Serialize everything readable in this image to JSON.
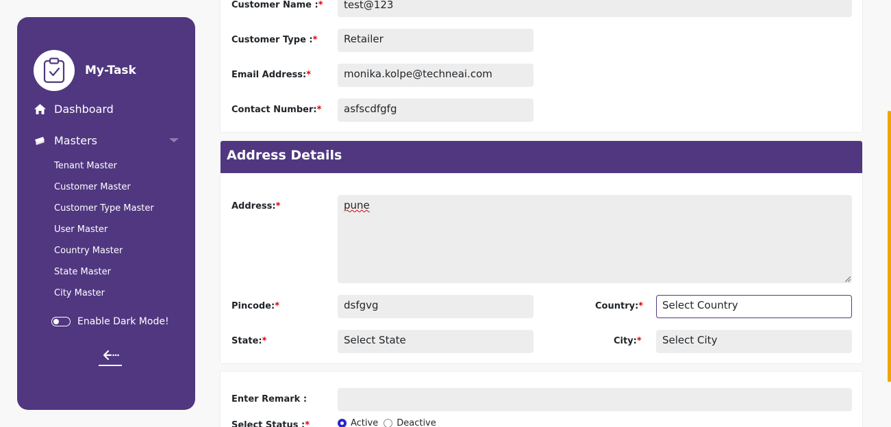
{
  "sidebar": {
    "app_title": "My-Task",
    "dashboard_label": "Dashboard",
    "masters_label": "Masters",
    "submenu": [
      "Tenant Master",
      "Customer Master",
      "Customer Type Master",
      "User Master",
      "Country Master",
      "State Master",
      "City Master"
    ],
    "dark_mode_label": "Enable Dark Mode!"
  },
  "customer": {
    "name_label": "Customer Name :",
    "name_value": "test@123",
    "type_label": "Customer Type :",
    "type_value": "Retailer",
    "email_label": "Email Address:",
    "email_value": "monika.kolpe@techneai.com",
    "contact_label": "Contact Number:",
    "contact_value": "asfscdfgfg"
  },
  "address": {
    "header": "Address Details",
    "address_label": "Address:",
    "address_value": "pune",
    "pincode_label": "Pincode:",
    "pincode_value": "dsfgvg",
    "country_label": "Country:",
    "country_value": "Select Country",
    "state_label": "State:",
    "state_value": "Select State",
    "city_label": "City:",
    "city_value": "Select City"
  },
  "remarks": {
    "remark_label": "Enter Remark :",
    "remark_value": "",
    "status_label": "Select Status :",
    "status_options": [
      "Active",
      "Deactive"
    ],
    "status_selected": "Active"
  },
  "required_mark": "*",
  "colors": {
    "brand": "#503780",
    "required": "#e00000",
    "field_bg": "#ededed",
    "scrollbar": "#f0a500"
  },
  "icons": [
    "clipboard-check-icon",
    "home-icon",
    "ticket-icon",
    "chevron-down-icon",
    "back-arrow-icon"
  ]
}
